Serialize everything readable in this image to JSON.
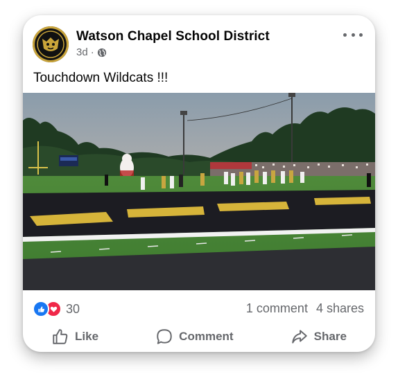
{
  "post": {
    "page_name": "Watson Chapel School District",
    "time": "3d",
    "separator": "·",
    "text": "Touchdown Wildcats !!!"
  },
  "reactions": {
    "count": "30",
    "comments": "1 comment",
    "shares": "4 shares"
  },
  "actions": {
    "like": "Like",
    "comment": "Comment",
    "share": "Share"
  },
  "icons": {
    "globe": "globe-icon",
    "more": "more-options-icon",
    "like_reaction": "like-reaction-icon",
    "love_reaction": "love-reaction-icon"
  },
  "colors": {
    "brand_blue": "#1877f2",
    "love_red": "#f02849",
    "secondary_text": "#65676b"
  }
}
